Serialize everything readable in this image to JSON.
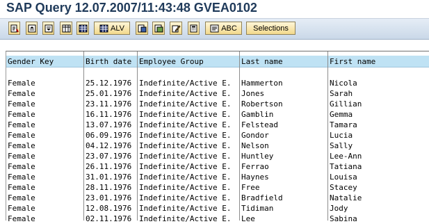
{
  "window": {
    "title": "SAP Query 12.07.2007/11:43:48 GVEA0102"
  },
  "toolbar": {
    "buttons": [
      {
        "icon": "select-detail-icon",
        "label": ""
      },
      {
        "icon": "sort-ascending-icon",
        "label": ""
      },
      {
        "icon": "sort-descending-icon",
        "label": ""
      },
      {
        "icon": "choose-layout-icon",
        "label": ""
      },
      {
        "icon": "table-grid-icon",
        "label": ""
      },
      {
        "icon": "alv-grid-icon",
        "label": "ALV"
      },
      {
        "icon": "word-processing-icon",
        "label": ""
      },
      {
        "icon": "spreadsheet-export-icon",
        "label": ""
      },
      {
        "icon": "edit-pencil-icon",
        "label": ""
      },
      {
        "icon": "calculator-icon",
        "label": ""
      },
      {
        "icon": "text-export-icon",
        "label": "ABC"
      },
      {
        "icon": "",
        "label": "Selections"
      }
    ]
  },
  "table": {
    "columns": [
      "Gender Key",
      "Birth date",
      "Employee Group",
      "Last name",
      "First name"
    ],
    "rows": [
      [
        "Female",
        "25.12.1976",
        "Indefinite/Active E.",
        "Hammerton",
        "Nicola"
      ],
      [
        "Female",
        "25.01.1976",
        "Indefinite/Active E.",
        "Jones",
        "Sarah"
      ],
      [
        "Female",
        "23.11.1976",
        "Indefinite/Active E.",
        "Robertson",
        "Gillian"
      ],
      [
        "Female",
        "16.11.1976",
        "Indefinite/Active E.",
        "Gamblin",
        "Gemma"
      ],
      [
        "Female",
        "13.07.1976",
        "Indefinite/Active E.",
        "Felstead",
        "Tamara"
      ],
      [
        "Female",
        "06.09.1976",
        "Indefinite/Active E.",
        "Gondor",
        "Lucia"
      ],
      [
        "Female",
        "04.12.1976",
        "Indefinite/Active E.",
        "Nelson",
        "Sally"
      ],
      [
        "Female",
        "23.07.1976",
        "Indefinite/Active E.",
        "Huntley",
        "Lee-Ann"
      ],
      [
        "Female",
        "26.11.1976",
        "Indefinite/Active E.",
        "Ferrao",
        "Tatiana"
      ],
      [
        "Female",
        "31.01.1976",
        "Indefinite/Active E.",
        "Haynes",
        "Louisa"
      ],
      [
        "Female",
        "28.11.1976",
        "Indefinite/Active E.",
        "Free",
        "Stacey"
      ],
      [
        "Female",
        "23.01.1976",
        "Indefinite/Active E.",
        "Bradfield",
        "Natalie"
      ],
      [
        "Female",
        "12.08.1976",
        "Indefinite/Active E.",
        "Tidiman",
        "Jody"
      ],
      [
        "Female",
        "02.11.1976",
        "Indefinite/Active E.",
        "Lee",
        "Sabina"
      ]
    ]
  }
}
